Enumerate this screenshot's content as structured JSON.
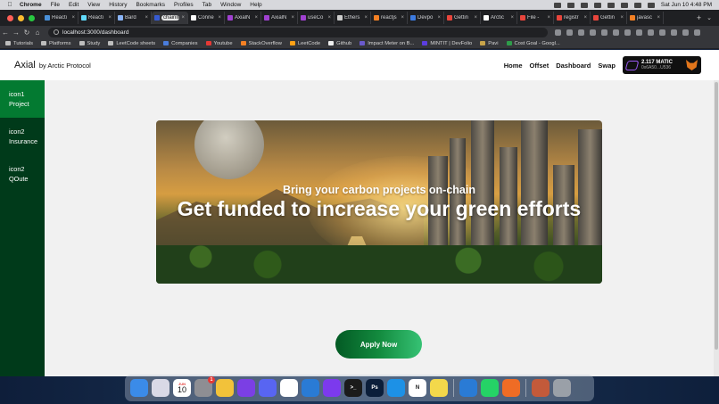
{
  "menubar": {
    "items": [
      "Chrome",
      "File",
      "Edit",
      "View",
      "History",
      "Bookmarks",
      "Profiles",
      "Tab",
      "Window",
      "Help"
    ],
    "clock": "Sat Jun 10  4:48 PM"
  },
  "browser": {
    "tabs": [
      {
        "label": "Reacti",
        "favicon_color": "#4a90d9",
        "active": false
      },
      {
        "label": "Reacti",
        "favicon_color": "#61dafb",
        "active": false
      },
      {
        "label": "Bard",
        "favicon_color": "#8ab4f8",
        "active": false
      },
      {
        "label": "chainlink",
        "favicon_color": "#375bd2",
        "active": true
      },
      {
        "label": "Conne",
        "favicon_color": "#ffffff",
        "active": false
      },
      {
        "label": "AxialN",
        "favicon_color": "#a041d1",
        "active": false
      },
      {
        "label": "AxialN",
        "favicon_color": "#a041d1",
        "active": false
      },
      {
        "label": "useCo",
        "favicon_color": "#a041d1",
        "active": false
      },
      {
        "label": "Ethers",
        "favicon_color": "#cccccc",
        "active": false
      },
      {
        "label": "reactjs",
        "favicon_color": "#f48024",
        "active": false
      },
      {
        "label": "Devpo",
        "favicon_color": "#3c7ae0",
        "active": false
      },
      {
        "label": "Gettin",
        "favicon_color": "#e8453c",
        "active": false
      },
      {
        "label": "Arctic",
        "favicon_color": "#ffffff",
        "active": false
      },
      {
        "label": "File -",
        "favicon_color": "#e8453c",
        "active": false
      },
      {
        "label": "registr",
        "favicon_color": "#e8453c",
        "active": false
      },
      {
        "label": "Gettin",
        "favicon_color": "#e8453c",
        "active": false
      },
      {
        "label": "javasc",
        "favicon_color": "#f48024",
        "active": false
      }
    ],
    "url": "localhost:3000/dashboard",
    "bookmarks": [
      {
        "label": "Tutorials",
        "color": "#bdbdbd"
      },
      {
        "label": "Platforms",
        "color": "#bdbdbd"
      },
      {
        "label": "Study",
        "color": "#bdbdbd"
      },
      {
        "label": "LeetCode sheets",
        "color": "#bdbdbd"
      },
      {
        "label": "Companies",
        "color": "#4a7ddc"
      },
      {
        "label": "Youtube",
        "color": "#e53935"
      },
      {
        "label": "StackOverflow",
        "color": "#f48024"
      },
      {
        "label": "LeetCode",
        "color": "#ffa116"
      },
      {
        "label": "Github",
        "color": "#eeeeee"
      },
      {
        "label": "Impact Meter on B...",
        "color": "#6a5acd"
      },
      {
        "label": "MINTIT | DevFolio",
        "color": "#5b3ee0"
      },
      {
        "label": "Pavi",
        "color": "#c7a34a"
      },
      {
        "label": "Cost Goal - Googl...",
        "color": "#2e9c4a"
      }
    ]
  },
  "header": {
    "brand": "Axial",
    "brand_sub": "by Arctic Protocol",
    "nav": [
      "Home",
      "Offset",
      "Dashboard",
      "Swap"
    ],
    "wallet": {
      "amount": "2.117 MATIC",
      "address": "0x6A50...U536"
    }
  },
  "sidebar": {
    "items": [
      {
        "icon": "icon1",
        "label": "Project",
        "active": true
      },
      {
        "icon": "icon2",
        "label": "Insurance",
        "active": false
      },
      {
        "icon": "icon2",
        "label": "QOute",
        "active": false
      }
    ]
  },
  "hero": {
    "subtitle": "Bring your carbon projects on-chain",
    "title": "Get funded to increase your green efforts"
  },
  "cta": {
    "label": "Apply Now"
  },
  "dock": {
    "calendar": {
      "month": "JUN",
      "day": "10"
    },
    "settings_badge": "1",
    "apps": [
      {
        "name": "finder",
        "color": "#3b8be8",
        "glyph": ""
      },
      {
        "name": "launchpad",
        "color": "#d9d9e6",
        "glyph": ""
      },
      {
        "name": "chrome",
        "color": "#f2c23a",
        "glyph": ""
      },
      {
        "name": "github-desktop",
        "color": "#7b3fe4",
        "glyph": ""
      },
      {
        "name": "discord",
        "color": "#5865f2",
        "glyph": ""
      },
      {
        "name": "slack",
        "color": "#ffffff",
        "glyph": ""
      },
      {
        "name": "vscode",
        "color": "#2a7bd5",
        "glyph": ""
      },
      {
        "name": "figma-like",
        "color": "#7c3aed",
        "glyph": ""
      },
      {
        "name": "terminal",
        "color": "#1b1b1b",
        "glyph": ">_"
      },
      {
        "name": "photoshop",
        "color": "#0b1e3a",
        "glyph": "Ps"
      },
      {
        "name": "docker",
        "color": "#1d91e6",
        "glyph": ""
      },
      {
        "name": "notion",
        "color": "#ffffff",
        "glyph": "N"
      },
      {
        "name": "notes",
        "color": "#f3d84b",
        "glyph": ""
      }
    ],
    "recent_apps": [
      {
        "name": "vscode-recent",
        "color": "#2a7bd5",
        "glyph": ""
      },
      {
        "name": "whatsapp",
        "color": "#25d366",
        "glyph": ""
      },
      {
        "name": "postman",
        "color": "#ef6c25",
        "glyph": ""
      }
    ],
    "extra": [
      {
        "name": "photos",
        "color": "#c35a3a",
        "glyph": ""
      },
      {
        "name": "trash",
        "color": "#9aa0a8",
        "glyph": ""
      }
    ]
  }
}
